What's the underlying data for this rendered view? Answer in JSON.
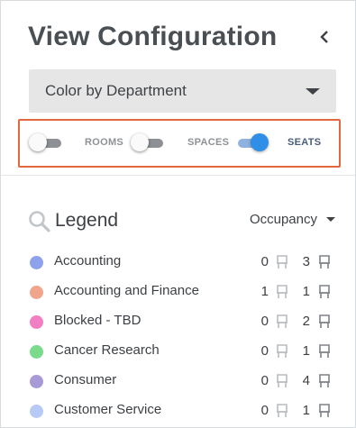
{
  "panel": {
    "title": "View Configuration",
    "collapse_icon": "chevron-left-icon"
  },
  "color_select": {
    "value": "Color by Department",
    "icon": "caret-down-icon"
  },
  "toggles": [
    {
      "label": "ROOMS",
      "on": false
    },
    {
      "label": "SPACES",
      "on": false
    },
    {
      "label": "SEATS",
      "on": true
    }
  ],
  "colors": {
    "highlight_border": "#e0673e",
    "toggle_on": "#2f8ee6"
  },
  "legend": {
    "title": "Legend",
    "search_icon": "search-icon",
    "sort_select": "Occupancy",
    "items": [
      {
        "label": "Accounting",
        "color": "#8ea2eb",
        "rooms": "0",
        "seats": "3"
      },
      {
        "label": "Accounting and Finance",
        "color": "#f0a58c",
        "rooms": "1",
        "seats": "1"
      },
      {
        "label": "Blocked - TBD",
        "color": "#f27ec3",
        "rooms": "0",
        "seats": "2"
      },
      {
        "label": "Cancer Research",
        "color": "#7adb8d",
        "rooms": "0",
        "seats": "1"
      },
      {
        "label": "Consumer",
        "color": "#a89ad6",
        "rooms": "0",
        "seats": "4"
      },
      {
        "label": "Customer Service",
        "color": "#b7c9f5",
        "rooms": "0",
        "seats": "1"
      }
    ]
  }
}
